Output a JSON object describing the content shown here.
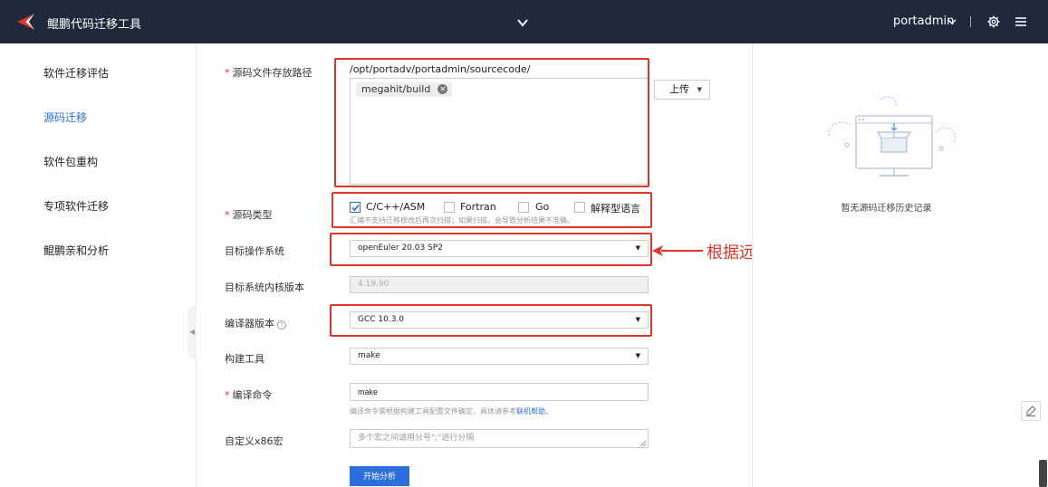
{
  "header": {
    "app_title": "鲲鹏代码迁移工具",
    "user_name": "portadmin",
    "separator": "|"
  },
  "sidebar": {
    "items": [
      {
        "label": "软件迁移评估",
        "active": false
      },
      {
        "label": "源码迁移",
        "active": true
      },
      {
        "label": "软件包重构",
        "active": false
      },
      {
        "label": "专项软件迁移",
        "active": false
      },
      {
        "label": "鲲鹏亲和分析",
        "active": false
      }
    ]
  },
  "form": {
    "source_path": {
      "label": "源码文件存放路径",
      "base_path": "/opt/portadv/portadmin/sourcecode/",
      "chip": "megahit/build",
      "upload_label": "上传"
    },
    "source_type": {
      "label": "源码类型",
      "options": [
        {
          "label": "C/C++/ASM",
          "checked": true
        },
        {
          "label": "Fortran",
          "checked": false
        },
        {
          "label": "Go",
          "checked": false
        },
        {
          "label": "解释型语言",
          "checked": false
        }
      ],
      "hint": "汇编不支持迁移修改后再次扫描；如果扫描，会导致分析结果不准确。"
    },
    "target_os": {
      "label": "目标操作系统",
      "value": "openEuler 20.03 SP2"
    },
    "kernel_version": {
      "label": "目标系统内核版本",
      "value": "4.19.90"
    },
    "compiler": {
      "label": "编译器版本",
      "value": "GCC 10.3.0"
    },
    "build_tool": {
      "label": "构建工具",
      "value": "make"
    },
    "build_command": {
      "label": "编译命令",
      "value": "make",
      "hint_prefix": "编译命令需根据构建工具配置文件确定，具体请参考",
      "hint_link": "联机帮助",
      "hint_suffix": "。"
    },
    "x86_macro": {
      "label": "自定义x86宏",
      "placeholder": "多个宏之间请用分号\";\"进行分隔"
    },
    "submit_label": "开始分析"
  },
  "annotation": {
    "text": "根据远程实验室的实际版本选择",
    "color": "#e0342b"
  },
  "history": {
    "empty_text": "暂无源码迁移历史记录"
  },
  "colors": {
    "header_bg": "#1e2a3c",
    "accent": "#2a6fdb",
    "required": "#e0342b"
  }
}
